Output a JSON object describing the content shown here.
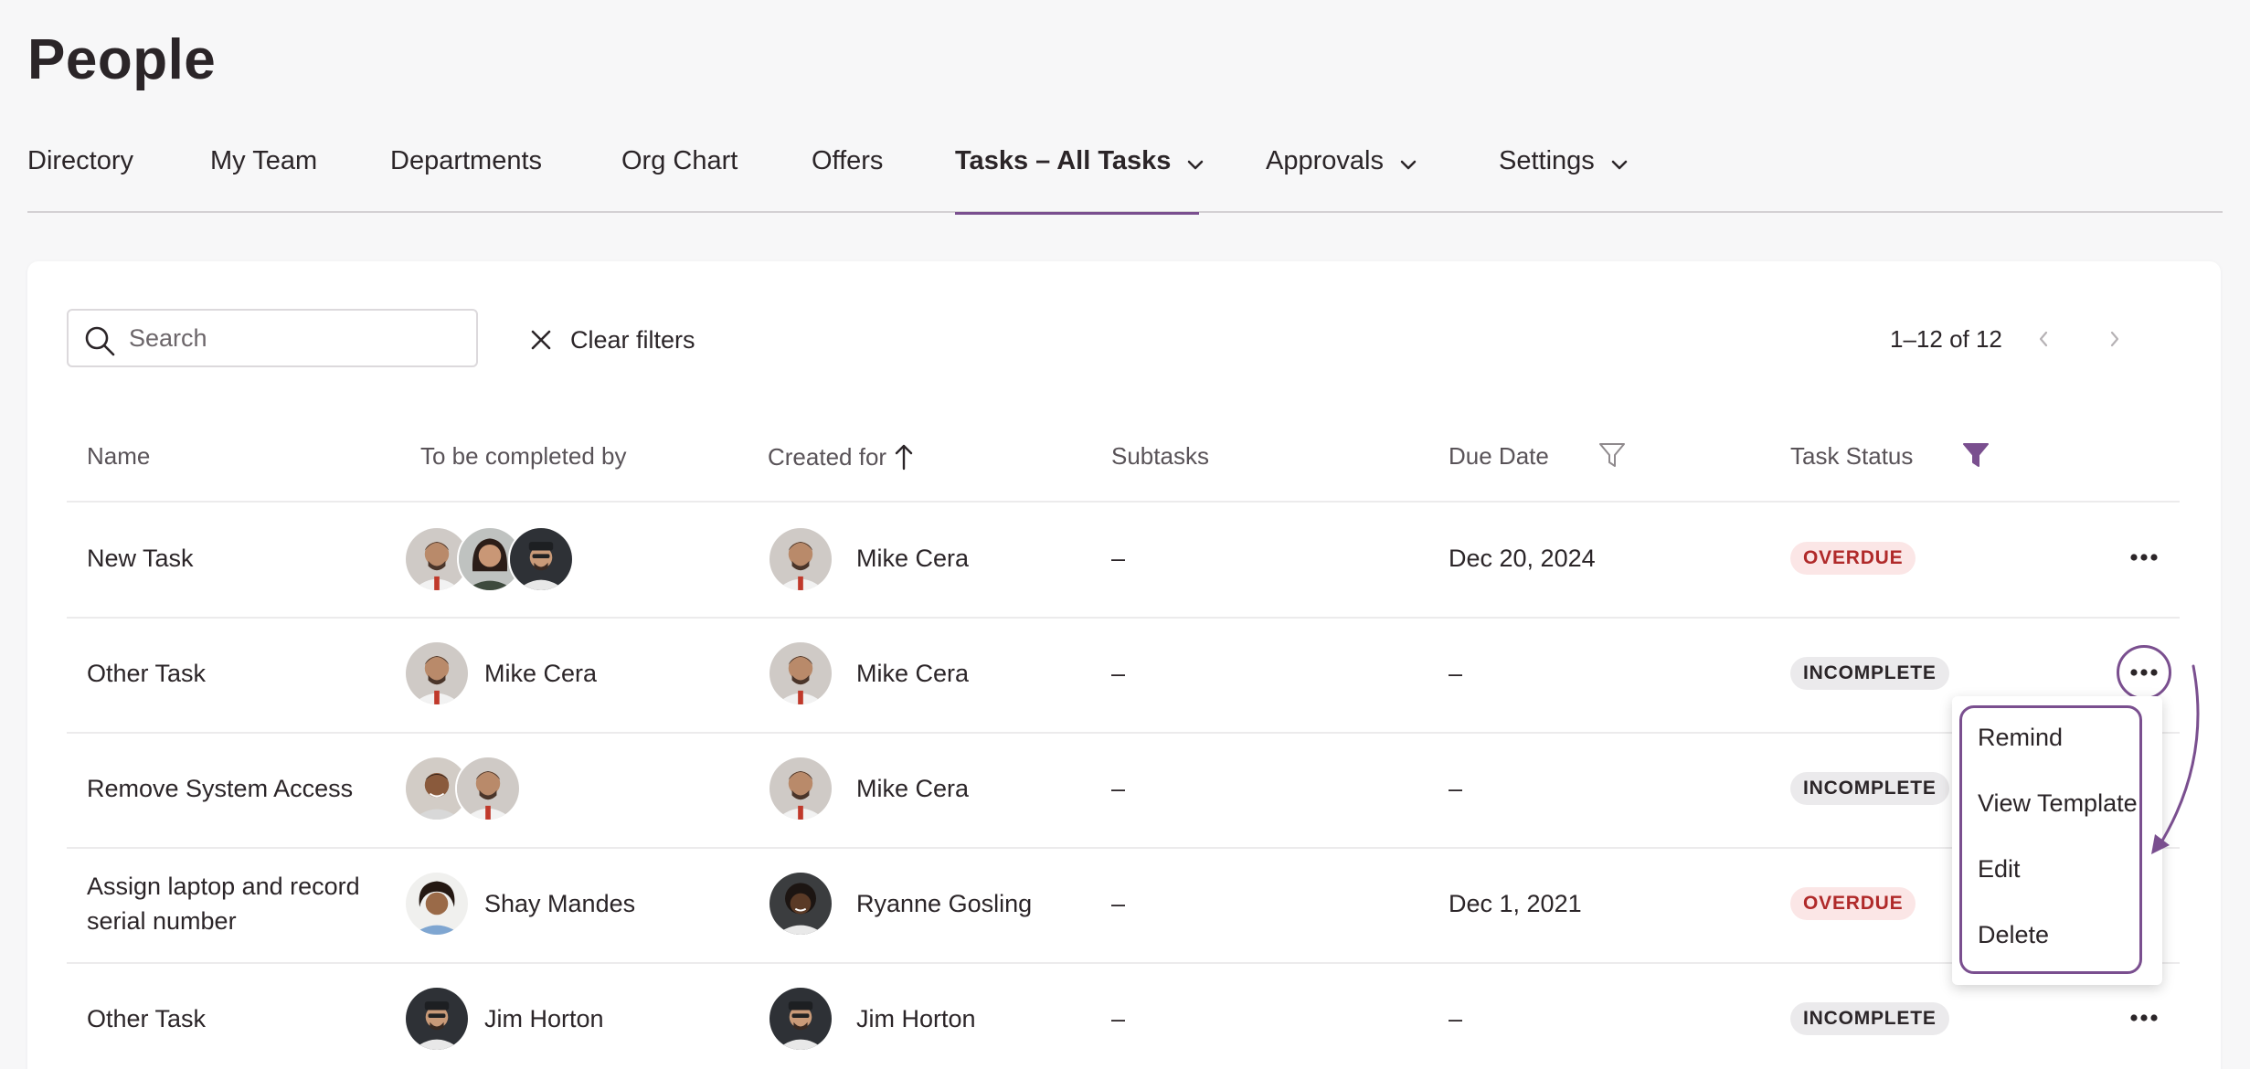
{
  "page": {
    "title": "People"
  },
  "tabs": [
    {
      "label": "Directory"
    },
    {
      "label": "My Team"
    },
    {
      "label": "Departments"
    },
    {
      "label": "Org Chart"
    },
    {
      "label": "Offers"
    },
    {
      "label": "Tasks – All Tasks",
      "active": true,
      "dropdown": true
    },
    {
      "label": "Approvals",
      "dropdown": true
    },
    {
      "label": "Settings",
      "dropdown": true
    }
  ],
  "toolbar": {
    "search_placeholder": "Search",
    "clear_filters_label": "Clear filters",
    "pagination": "1–12 of 12"
  },
  "table": {
    "columns": {
      "name": "Name",
      "completed_by": "To be completed by",
      "created_for": "Created for",
      "subtasks": "Subtasks",
      "due_date": "Due Date",
      "task_status": "Task Status"
    },
    "rows": [
      {
        "name": "New Task",
        "completed_by": "",
        "created_for": "Mike Cera",
        "subtasks": "–",
        "due_date": "Dec 20, 2024",
        "status": "OVERDUE"
      },
      {
        "name": "Other Task",
        "completed_by": "Mike Cera",
        "created_for": "Mike Cera",
        "subtasks": "–",
        "due_date": "–",
        "status": "INCOMPLETE"
      },
      {
        "name": "Remove System Access",
        "completed_by": "",
        "created_for": "Mike Cera",
        "subtasks": "–",
        "due_date": "–",
        "status": "INCOMPLETE"
      },
      {
        "name": "Assign laptop and record serial number",
        "completed_by": "Shay Mandes",
        "created_for": "Ryanne Gosling",
        "subtasks": "–",
        "due_date": "Dec 1, 2021",
        "status": "OVERDUE"
      },
      {
        "name": "Other Task",
        "completed_by": "Jim Horton",
        "created_for": "Jim Horton",
        "subtasks": "–",
        "due_date": "–",
        "status": "INCOMPLETE"
      }
    ]
  },
  "row_menu": {
    "items": [
      "Remind",
      "View Template",
      "Edit",
      "Delete"
    ]
  },
  "colors": {
    "accent": "#7a4f8f",
    "overdue_bg": "#fbe6e6",
    "overdue_text": "#b02a2a",
    "incomplete_bg": "#ebeaec"
  }
}
